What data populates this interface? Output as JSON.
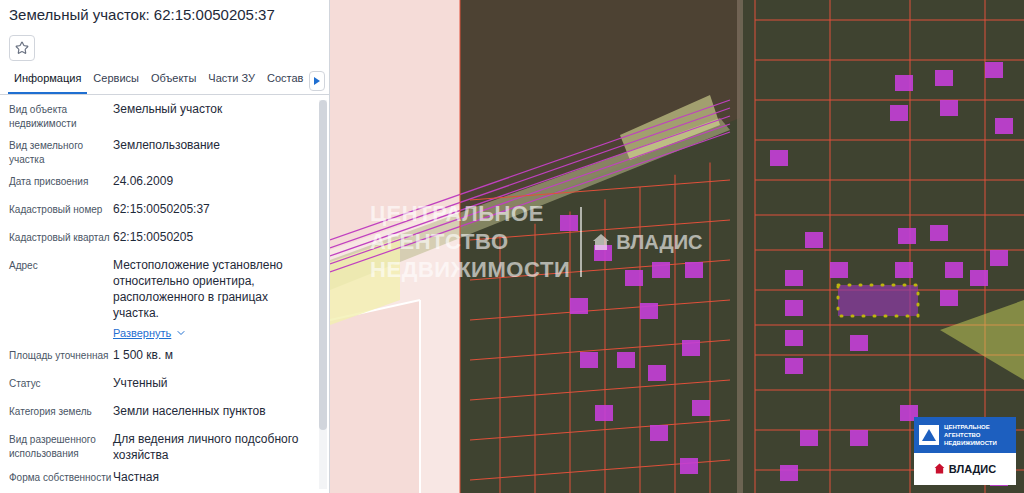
{
  "title": "Земельный участок: 62:15:0050205:37",
  "favorite": false,
  "tabs": [
    {
      "label": "Информация",
      "selected": true
    },
    {
      "label": "Сервисы",
      "selected": false
    },
    {
      "label": "Объекты",
      "selected": false
    },
    {
      "label": "Части ЗУ",
      "selected": false
    },
    {
      "label": "Состав",
      "selected": false
    }
  ],
  "fields": [
    {
      "label": "Вид объекта недвижимости",
      "value": "Земельный участок"
    },
    {
      "label": "Вид земельного участка",
      "value": "Землепользование"
    },
    {
      "label": "Дата присвоения",
      "value": "24.06.2009"
    },
    {
      "label": "Кадастровый номер",
      "value": "62:15:0050205:37"
    },
    {
      "label": "Кадастровый квартал",
      "value": "62:15:0050205"
    },
    {
      "label": "Адрес",
      "value": "Местоположение установлено относительно ориентира, расположенного в границах участка.",
      "link": "Развернуть"
    },
    {
      "label": "Площадь уточненная",
      "value": "1 500 кв. м"
    },
    {
      "label": "Статус",
      "value": "Учтенный"
    },
    {
      "label": "Категория земель",
      "value": "Земли населенных пунктов"
    },
    {
      "label": "Вид разрешенного использования",
      "value": "Для ведения личного подсобного хозяйства"
    },
    {
      "label": "Форма собственности",
      "value": "Частная"
    }
  ],
  "watermark": {
    "lines": [
      "ЦЕНТРАЛЬНОЕ",
      "АГЕНТСТВО",
      "НЕДВИЖИМОСТИ"
    ],
    "brand": "ВЛАДИС"
  },
  "logo": {
    "lines": [
      "ЦЕНТРАЛЬНОЕ",
      "АГЕНТСТВО",
      "НЕДВИЖИМОСТИ"
    ],
    "brand": "ВЛАДИС"
  }
}
